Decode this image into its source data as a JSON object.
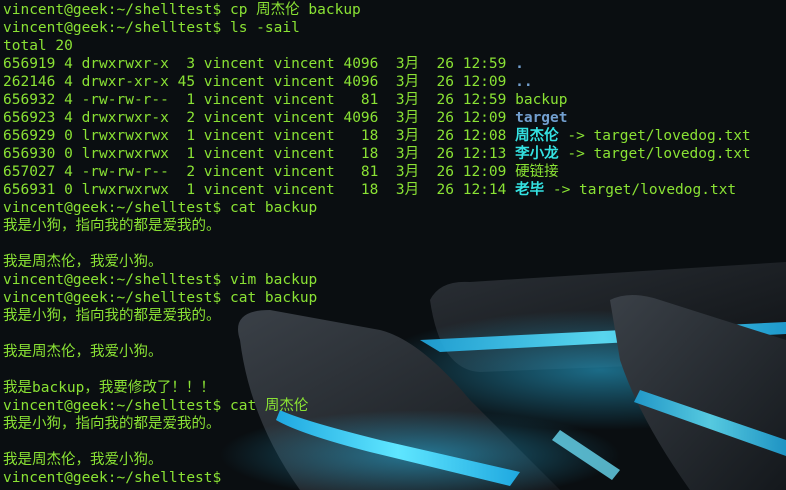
{
  "terminal": {
    "prompt": "vincent@geek:~/shelltest$",
    "cmd_cp": "cp 周杰伦 backup",
    "cmd_ls": "ls -sail",
    "total": "total 20",
    "listing": [
      {
        "meta": "656919 4 drwxrwxr-x  3 vincent vincent 4096  3月  26 12:59 ",
        "name": ".",
        "kind": "dir",
        "target": ""
      },
      {
        "meta": "262146 4 drwxr-xr-x 45 vincent vincent 4096  3月  26 12:09 ",
        "name": "..",
        "kind": "dir",
        "target": ""
      },
      {
        "meta": "656932 4 -rw-rw-r--  1 vincent vincent   81  3月  26 12:59 ",
        "name": "backup",
        "kind": "file",
        "target": ""
      },
      {
        "meta": "656923 4 drwxrwxr-x  2 vincent vincent 4096  3月  26 12:09 ",
        "name": "target",
        "kind": "dir",
        "target": ""
      },
      {
        "meta": "656929 0 lrwxrwxrwx  1 vincent vincent   18  3月  26 12:08 ",
        "name": "周杰伦",
        "kind": "link",
        "target": " -> target/lovedog.txt"
      },
      {
        "meta": "656930 0 lrwxrwxrwx  1 vincent vincent   18  3月  26 12:13 ",
        "name": "李小龙",
        "kind": "link",
        "target": " -> target/lovedog.txt"
      },
      {
        "meta": "657027 4 -rw-rw-r--  2 vincent vincent   81  3月  26 12:09 ",
        "name": "硬链接",
        "kind": "file",
        "target": ""
      },
      {
        "meta": "656931 0 lrwxrwxrwx  1 vincent vincent   18  3月  26 12:14 ",
        "name": "老毕",
        "kind": "link",
        "target": " -> target/lovedog.txt"
      }
    ],
    "cmd_cat_backup": "cat backup",
    "text_line1": "我是小狗，指向我的都是爱我的。",
    "text_line2": "我是周杰伦，我爱小狗。",
    "cmd_vim_backup": "vim backup",
    "text_line3": "我是backup，我要修改了！！！",
    "cmd_cat_zjl": "cat 周杰伦"
  }
}
